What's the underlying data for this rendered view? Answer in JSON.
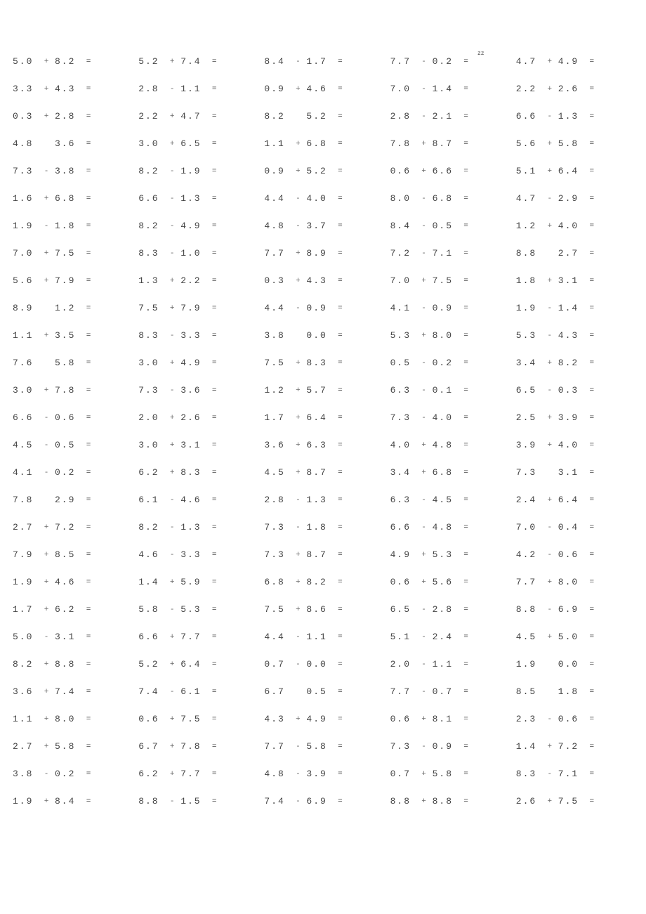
{
  "page": {
    "columns": 5,
    "rows": 28
  },
  "problems": [
    [
      {
        "a": "5.0",
        "op": "+",
        "b": "8.2",
        "eq": "="
      },
      {
        "a": "5.2",
        "op": "+",
        "b": "7.4",
        "eq": "="
      },
      {
        "a": "8.4",
        "op": "-",
        "b": "1.7",
        "eq": "="
      },
      {
        "a": "7.7",
        "op": "-",
        "b": "0.2",
        "eq": "=",
        "sup": "zz"
      },
      {
        "a": "4.7",
        "op": "+",
        "b": "4.9",
        "eq": "="
      }
    ],
    [
      {
        "a": "3.3",
        "op": "+",
        "b": "4.3",
        "eq": "="
      },
      {
        "a": "2.8",
        "op": "-",
        "b": "1.1",
        "eq": "="
      },
      {
        "a": "0.9",
        "op": "+",
        "b": "4.6",
        "eq": "="
      },
      {
        "a": "7.0",
        "op": "-",
        "b": "1.4",
        "eq": "="
      },
      {
        "a": "2.2",
        "op": "+",
        "b": "2.6",
        "eq": "="
      }
    ],
    [
      {
        "a": "0.3",
        "op": "+",
        "b": "2.8",
        "eq": "="
      },
      {
        "a": "2.2",
        "op": "+",
        "b": "4.7",
        "eq": "="
      },
      {
        "a": "8.2",
        "op": "",
        "b": "5.2",
        "eq": "="
      },
      {
        "a": "2.8",
        "op": "-",
        "b": "2.1",
        "eq": "="
      },
      {
        "a": "6.6",
        "op": "-",
        "b": "1.3",
        "eq": "="
      }
    ],
    [
      {
        "a": "4.8",
        "op": "",
        "b": "3.6",
        "eq": "="
      },
      {
        "a": "3.0",
        "op": "+",
        "b": "6.5",
        "eq": "="
      },
      {
        "a": "1.1",
        "op": "+",
        "b": "6.8",
        "eq": "="
      },
      {
        "a": "7.8",
        "op": "+",
        "b": "8.7",
        "eq": "="
      },
      {
        "a": "5.6",
        "op": "+",
        "b": "5.8",
        "eq": "="
      }
    ],
    [
      {
        "a": "7.3",
        "op": "-",
        "b": "3.8",
        "eq": "="
      },
      {
        "a": "8.2",
        "op": "-",
        "b": "1.9",
        "eq": "="
      },
      {
        "a": "0.9",
        "op": "+",
        "b": "5.2",
        "eq": "="
      },
      {
        "a": "0.6",
        "op": "+",
        "b": "6.6",
        "eq": "="
      },
      {
        "a": "5.1",
        "op": "+",
        "b": "6.4",
        "eq": "="
      }
    ],
    [
      {
        "a": "1.6",
        "op": "+",
        "b": "6.8",
        "eq": "="
      },
      {
        "a": "6.6",
        "op": "-",
        "b": "1.3",
        "eq": "="
      },
      {
        "a": "4.4",
        "op": "-",
        "b": "4.0",
        "eq": "="
      },
      {
        "a": "8.0",
        "op": "-",
        "b": "6.8",
        "eq": "="
      },
      {
        "a": "4.7",
        "op": "-",
        "b": "2.9",
        "eq": "="
      }
    ],
    [
      {
        "a": "1.9",
        "op": "-",
        "b": "1.8",
        "eq": "="
      },
      {
        "a": "8.2",
        "op": "-",
        "b": "4.9",
        "eq": "="
      },
      {
        "a": "4.8",
        "op": "-",
        "b": "3.7",
        "eq": "="
      },
      {
        "a": "8.4",
        "op": "-",
        "b": "0.5",
        "eq": "="
      },
      {
        "a": "1.2",
        "op": "+",
        "b": "4.0",
        "eq": "="
      }
    ],
    [
      {
        "a": "7.0",
        "op": "+",
        "b": "7.5",
        "eq": "="
      },
      {
        "a": "8.3",
        "op": "-",
        "b": "1.0",
        "eq": "="
      },
      {
        "a": "7.7",
        "op": "+",
        "b": "8.9",
        "eq": "="
      },
      {
        "a": "7.2",
        "op": "-",
        "b": "7.1",
        "eq": "="
      },
      {
        "a": "8.8",
        "op": "",
        "b": "2.7",
        "eq": "="
      }
    ],
    [
      {
        "a": "5.6",
        "op": "+",
        "b": "7.9",
        "eq": "="
      },
      {
        "a": "1.3",
        "op": "+",
        "b": "2.2",
        "eq": "="
      },
      {
        "a": "0.3",
        "op": "+",
        "b": "4.3",
        "eq": "="
      },
      {
        "a": "7.0",
        "op": "+",
        "b": "7.5",
        "eq": "="
      },
      {
        "a": "1.8",
        "op": "+",
        "b": "3.1",
        "eq": "="
      }
    ],
    [
      {
        "a": "8.9",
        "op": "",
        "b": "1.2",
        "eq": "="
      },
      {
        "a": "7.5",
        "op": "+",
        "b": "7.9",
        "eq": "="
      },
      {
        "a": "4.4",
        "op": "-",
        "b": "0.9",
        "eq": "="
      },
      {
        "a": "4.1",
        "op": "-",
        "b": "0.9",
        "eq": "="
      },
      {
        "a": "1.9",
        "op": "-",
        "b": "1.4",
        "eq": "="
      }
    ],
    [
      {
        "a": "1.1",
        "op": "+",
        "b": "3.5",
        "eq": "="
      },
      {
        "a": "8.3",
        "op": "-",
        "b": "3.3",
        "eq": "="
      },
      {
        "a": "3.8",
        "op": "",
        "b": "0.0",
        "eq": "="
      },
      {
        "a": "5.3",
        "op": "+",
        "b": "8.0",
        "eq": "="
      },
      {
        "a": "5.3",
        "op": "-",
        "b": "4.3",
        "eq": "="
      }
    ],
    [
      {
        "a": "7.6",
        "op": "",
        "b": "5.8",
        "eq": "="
      },
      {
        "a": "3.0",
        "op": "+",
        "b": "4.9",
        "eq": "="
      },
      {
        "a": "7.5",
        "op": "+",
        "b": "8.3",
        "eq": "="
      },
      {
        "a": "0.5",
        "op": "-",
        "b": "0.2",
        "eq": "="
      },
      {
        "a": "3.4",
        "op": "+",
        "b": "8.2",
        "eq": "="
      }
    ],
    [
      {
        "a": "3.0",
        "op": "+",
        "b": "7.8",
        "eq": "="
      },
      {
        "a": "7.3",
        "op": "-",
        "b": "3.6",
        "eq": "="
      },
      {
        "a": "1.2",
        "op": "+",
        "b": "5.7",
        "eq": "="
      },
      {
        "a": "6.3",
        "op": "-",
        "b": "0.1",
        "eq": "="
      },
      {
        "a": "6.5",
        "op": "-",
        "b": "0.3",
        "eq": "="
      }
    ],
    [
      {
        "a": "6.6",
        "op": "-",
        "b": "0.6",
        "eq": "="
      },
      {
        "a": "2.0",
        "op": "+",
        "b": "2.6",
        "eq": "="
      },
      {
        "a": "1.7",
        "op": "+",
        "b": "6.4",
        "eq": "="
      },
      {
        "a": "7.3",
        "op": "-",
        "b": "4.0",
        "eq": "="
      },
      {
        "a": "2.5",
        "op": "+",
        "b": "3.9",
        "eq": "="
      }
    ],
    [
      {
        "a": "4.5",
        "op": "-",
        "b": "0.5",
        "eq": "="
      },
      {
        "a": "3.0",
        "op": "+",
        "b": "3.1",
        "eq": "="
      },
      {
        "a": "3.6",
        "op": "+",
        "b": "6.3",
        "eq": "="
      },
      {
        "a": "4.0",
        "op": "+",
        "b": "4.8",
        "eq": "="
      },
      {
        "a": "3.9",
        "op": "+",
        "b": "4.0",
        "eq": "="
      }
    ],
    [
      {
        "a": "4.1",
        "op": "-",
        "b": "0.2",
        "eq": "="
      },
      {
        "a": "6.2",
        "op": "+",
        "b": "8.3",
        "eq": "="
      },
      {
        "a": "4.5",
        "op": "+",
        "b": "8.7",
        "eq": "="
      },
      {
        "a": "3.4",
        "op": "+",
        "b": "6.8",
        "eq": "="
      },
      {
        "a": "7.3",
        "op": "",
        "b": "3.1",
        "eq": "="
      }
    ],
    [
      {
        "a": "7.8",
        "op": "",
        "b": "2.9",
        "eq": "="
      },
      {
        "a": "6.1",
        "op": "-",
        "b": "4.6",
        "eq": "="
      },
      {
        "a": "2.8",
        "op": "-",
        "b": "1.3",
        "eq": "="
      },
      {
        "a": "6.3",
        "op": "-",
        "b": "4.5",
        "eq": "="
      },
      {
        "a": "2.4",
        "op": "+",
        "b": "6.4",
        "eq": "="
      }
    ],
    [
      {
        "a": "2.7",
        "op": "+",
        "b": "7.2",
        "eq": "="
      },
      {
        "a": "8.2",
        "op": "-",
        "b": "1.3",
        "eq": "="
      },
      {
        "a": "7.3",
        "op": "-",
        "b": "1.8",
        "eq": "="
      },
      {
        "a": "6.6",
        "op": "-",
        "b": "4.8",
        "eq": "="
      },
      {
        "a": "7.0",
        "op": "-",
        "b": "0.4",
        "eq": "="
      }
    ],
    [
      {
        "a": "7.9",
        "op": "+",
        "b": "8.5",
        "eq": "="
      },
      {
        "a": "4.6",
        "op": "-",
        "b": "3.3",
        "eq": "="
      },
      {
        "a": "7.3",
        "op": "+",
        "b": "8.7",
        "eq": "="
      },
      {
        "a": "4.9",
        "op": "+",
        "b": "5.3",
        "eq": "="
      },
      {
        "a": "4.2",
        "op": "-",
        "b": "0.6",
        "eq": "="
      }
    ],
    [
      {
        "a": "1.9",
        "op": "+",
        "b": "4.6",
        "eq": "="
      },
      {
        "a": "1.4",
        "op": "+",
        "b": "5.9",
        "eq": "="
      },
      {
        "a": "6.8",
        "op": "+",
        "b": "8.2",
        "eq": "="
      },
      {
        "a": "0.6",
        "op": "+",
        "b": "5.6",
        "eq": "="
      },
      {
        "a": "7.7",
        "op": "+",
        "b": "8.0",
        "eq": "="
      }
    ],
    [
      {
        "a": "1.7",
        "op": "+",
        "b": "6.2",
        "eq": "="
      },
      {
        "a": "5.8",
        "op": "-",
        "b": "5.3",
        "eq": "="
      },
      {
        "a": "7.5",
        "op": "+",
        "b": "8.6",
        "eq": "="
      },
      {
        "a": "6.5",
        "op": "-",
        "b": "2.8",
        "eq": "="
      },
      {
        "a": "8.8",
        "op": "-",
        "b": "6.9",
        "eq": "="
      }
    ],
    [
      {
        "a": "5.0",
        "op": "-",
        "b": "3.1",
        "eq": "="
      },
      {
        "a": "6.6",
        "op": "+",
        "b": "7.7",
        "eq": "="
      },
      {
        "a": "4.4",
        "op": "-",
        "b": "1.1",
        "eq": "="
      },
      {
        "a": "5.1",
        "op": "-",
        "b": "2.4",
        "eq": "="
      },
      {
        "a": "4.5",
        "op": "+",
        "b": "5.0",
        "eq": "="
      }
    ],
    [
      {
        "a": "8.2",
        "op": "+",
        "b": "8.8",
        "eq": "="
      },
      {
        "a": "5.2",
        "op": "+",
        "b": "6.4",
        "eq": "="
      },
      {
        "a": "0.7",
        "op": "-",
        "b": "0.0",
        "eq": "="
      },
      {
        "a": "2.0",
        "op": "-",
        "b": "1.1",
        "eq": "="
      },
      {
        "a": "1.9",
        "op": "",
        "b": "0.0",
        "eq": "="
      }
    ],
    [
      {
        "a": "3.6",
        "op": "+",
        "b": "7.4",
        "eq": "="
      },
      {
        "a": "7.4",
        "op": "-",
        "b": "6.1",
        "eq": "="
      },
      {
        "a": "6.7",
        "op": "",
        "b": "0.5",
        "eq": "="
      },
      {
        "a": "7.7",
        "op": "-",
        "b": "0.7",
        "eq": "="
      },
      {
        "a": "8.5",
        "op": "",
        "b": "1.8",
        "eq": "="
      }
    ],
    [
      {
        "a": "1.1",
        "op": "+",
        "b": "8.0",
        "eq": "="
      },
      {
        "a": "0.6",
        "op": "+",
        "b": "7.5",
        "eq": "="
      },
      {
        "a": "4.3",
        "op": "+",
        "b": "4.9",
        "eq": "="
      },
      {
        "a": "0.6",
        "op": "+",
        "b": "8.1",
        "eq": "="
      },
      {
        "a": "2.3",
        "op": "-",
        "b": "0.6",
        "eq": "="
      }
    ],
    [
      {
        "a": "2.7",
        "op": "+",
        "b": "5.8",
        "eq": "="
      },
      {
        "a": "6.7",
        "op": "+",
        "b": "7.8",
        "eq": "="
      },
      {
        "a": "7.7",
        "op": "-",
        "b": "5.8",
        "eq": "="
      },
      {
        "a": "7.3",
        "op": "-",
        "b": "0.9",
        "eq": "="
      },
      {
        "a": "1.4",
        "op": "+",
        "b": "7.2",
        "eq": "="
      }
    ],
    [
      {
        "a": "3.8",
        "op": "-",
        "b": "0.2",
        "eq": "="
      },
      {
        "a": "6.2",
        "op": "+",
        "b": "7.7",
        "eq": "="
      },
      {
        "a": "4.8",
        "op": "-",
        "b": "3.9",
        "eq": "="
      },
      {
        "a": "0.7",
        "op": "+",
        "b": "5.8",
        "eq": "="
      },
      {
        "a": "8.3",
        "op": "-",
        "b": "7.1",
        "eq": "="
      }
    ],
    [
      {
        "a": "1.9",
        "op": "+",
        "b": "8.4",
        "eq": "="
      },
      {
        "a": "8.8",
        "op": "-",
        "b": "1.5",
        "eq": "="
      },
      {
        "a": "7.4",
        "op": "-",
        "b": "6.9",
        "eq": "="
      },
      {
        "a": "8.8",
        "op": "+",
        "b": "8.8",
        "eq": "="
      },
      {
        "a": "2.6",
        "op": "+",
        "b": "7.5",
        "eq": "="
      }
    ]
  ]
}
